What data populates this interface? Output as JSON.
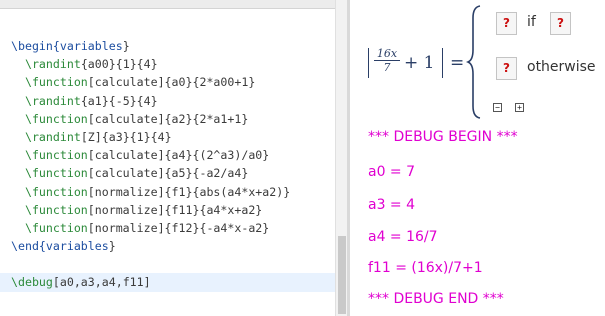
{
  "editor": {
    "lines": [
      [
        [
          "env",
          "\\begin{"
        ],
        [
          "env",
          "variables"
        ],
        [
          "plain",
          "}"
        ]
      ],
      [
        [
          "cmd",
          "  \\randint"
        ],
        [
          "plain",
          "{a00}{"
        ],
        [
          "plain",
          "1"
        ],
        [
          "plain",
          "}{"
        ],
        [
          "plain",
          "4"
        ],
        [
          "plain",
          "}"
        ]
      ],
      [
        [
          "cmd",
          "  \\function"
        ],
        [
          "plain",
          "[calculate]{a0}{2*a00+1}"
        ]
      ],
      [
        [
          "cmd",
          "  \\randint"
        ],
        [
          "plain",
          "{a1}{-5}{4}"
        ]
      ],
      [
        [
          "cmd",
          "  \\function"
        ],
        [
          "plain",
          "[calculate]{a2}{2*a1+1}"
        ]
      ],
      [
        [
          "cmd",
          "  \\randint"
        ],
        [
          "plain",
          "[Z]{a3}{1}{4}"
        ]
      ],
      [
        [
          "cmd",
          "  \\function"
        ],
        [
          "plain",
          "[calculate]{a4}{(2^a3)/a0}"
        ]
      ],
      [
        [
          "cmd",
          "  \\function"
        ],
        [
          "plain",
          "[calculate]{a5}{-a2/a4}"
        ]
      ],
      [
        [
          "cmd",
          "  \\function"
        ],
        [
          "plain",
          "[normalize]{f1}{abs(a4*x+a2)}"
        ]
      ],
      [
        [
          "cmd",
          "  \\function"
        ],
        [
          "plain",
          "[normalize]{f11}{a4*x+a2}"
        ]
      ],
      [
        [
          "cmd",
          "  \\function"
        ],
        [
          "plain",
          "[normalize]{f12}{-a4*x-a2}"
        ]
      ],
      [
        [
          "env",
          "\\end{"
        ],
        [
          "env",
          "variables"
        ],
        [
          "plain",
          "}"
        ]
      ],
      [
        [
          "plain",
          ""
        ]
      ],
      [
        [
          "cmd",
          "\\debug"
        ],
        [
          "plain",
          "[a0,a3,a4,f11]"
        ]
      ]
    ]
  },
  "preview": {
    "math": {
      "frac_num": "16x",
      "frac_den": "7",
      "plus_one": "+ 1",
      "equals": "=",
      "placeholder": "?",
      "case_if": "if",
      "case_otherwise": "otherwise",
      "minus_glyph": "−",
      "plus_glyph": "+"
    },
    "debug": {
      "begin": "*** DEBUG BEGIN ***",
      "a0": "a0 = 7",
      "a3": "a3 = 4",
      "a4": "a4 = 16/7",
      "f11": "f11 = (16x)/7+1",
      "end": "*** DEBUG END ***"
    }
  },
  "colors": {
    "debug": "#e000d0",
    "command": "#2c8a3a",
    "env": "#1d4ea0",
    "placeholder": "#cc1111"
  }
}
